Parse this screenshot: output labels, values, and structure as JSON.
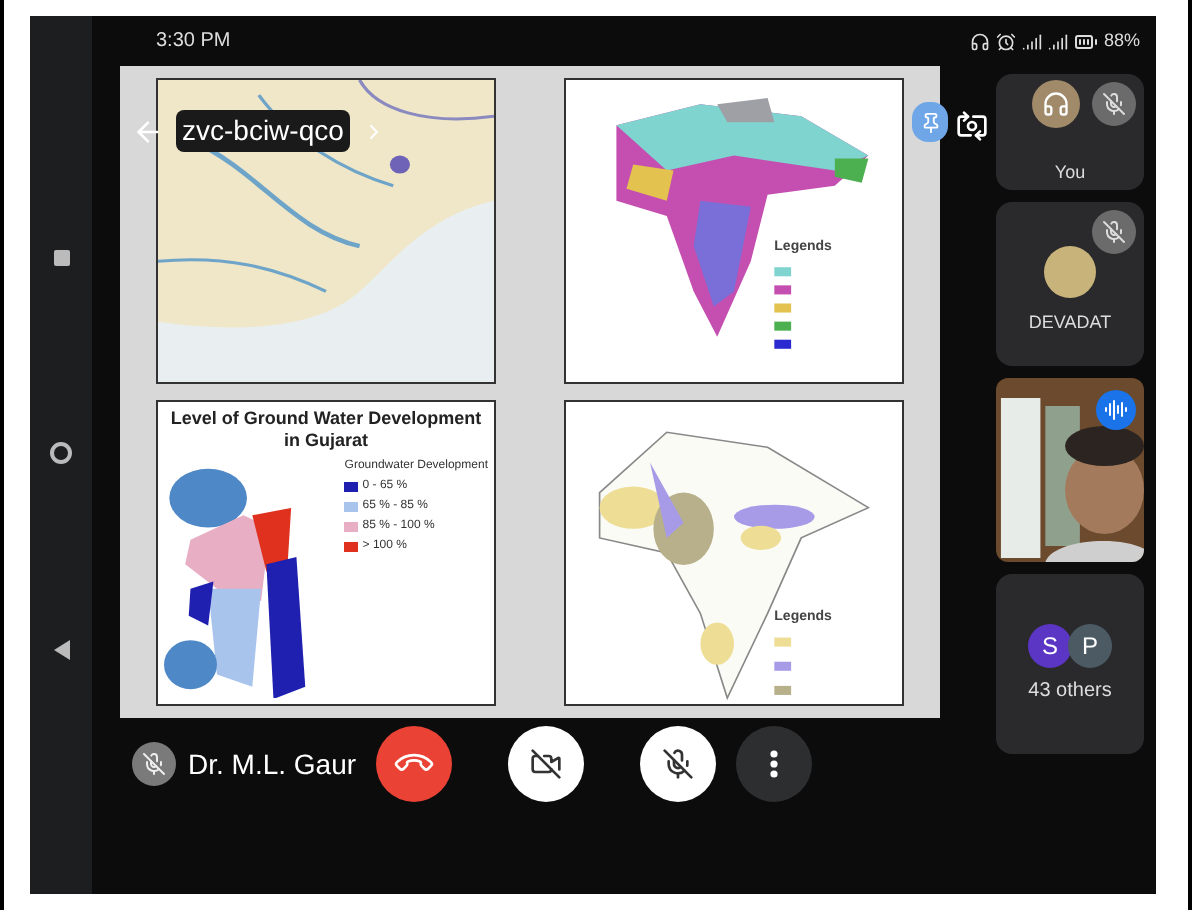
{
  "status_bar": {
    "time": "3:30 PM",
    "battery": "88%"
  },
  "meeting": {
    "code": "zvc-bciw-qco"
  },
  "panels": [
    {
      "kind": "map"
    },
    {
      "kind": "map",
      "legend_title": "Legends"
    },
    {
      "kind": "legend_map",
      "title": "Level of Ground Water Development in Gujarat",
      "legend_title": "Groundwater Development",
      "legend": [
        {
          "label": "0 - 65 %",
          "color": "#1f1fb0"
        },
        {
          "label": "65 % - 85 %",
          "color": "#a9c4ec"
        },
        {
          "label": "85 % - 100 %",
          "color": "#e8aec4"
        },
        {
          "label": "> 100 %",
          "color": "#e0301e"
        }
      ]
    },
    {
      "kind": "map",
      "legend_title": "Legends"
    }
  ],
  "presenter": {
    "name": "Dr. M.L. Gaur",
    "muted": true
  },
  "controls": {
    "camera_on": false,
    "mic_on": false
  },
  "participants": [
    {
      "kind": "self",
      "name": "You",
      "muted": true
    },
    {
      "kind": "avatar",
      "name": "DEVADAT",
      "muted": true
    },
    {
      "kind": "video",
      "speaking": true
    },
    {
      "kind": "others",
      "initials": [
        {
          "letter": "S",
          "color": "#5b35c4"
        },
        {
          "letter": "P",
          "color": "#4c5b63"
        }
      ],
      "label": "43 others"
    }
  ]
}
